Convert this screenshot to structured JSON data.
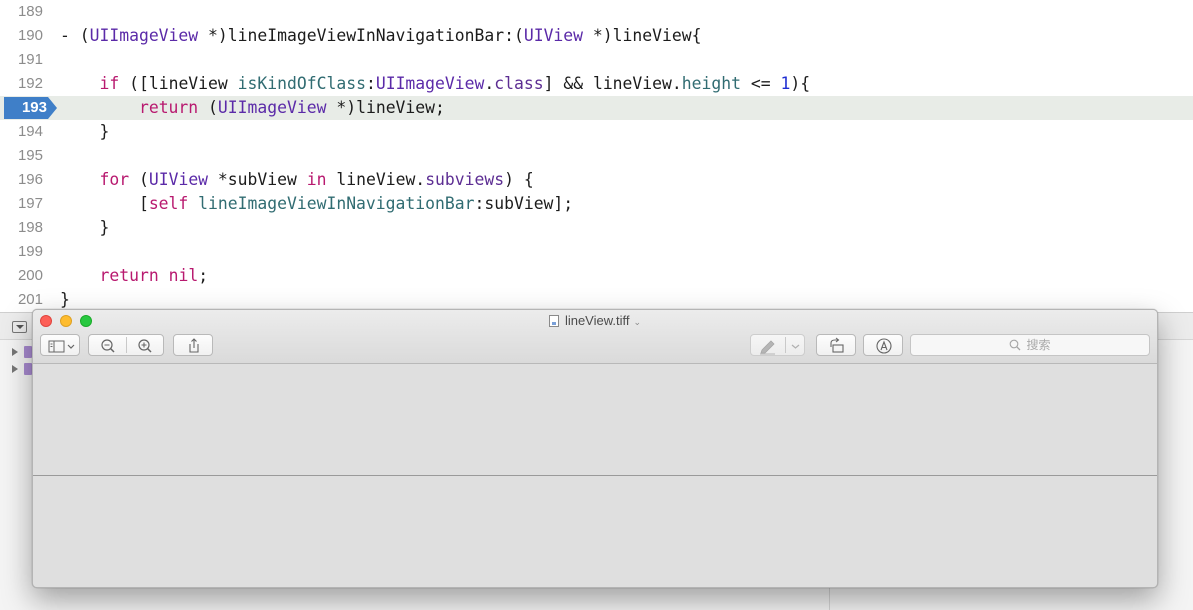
{
  "editor": {
    "lines": [
      {
        "num": "189",
        "tokens": []
      },
      {
        "num": "190",
        "tokens": [
          {
            "t": "- (",
            "c": "plain"
          },
          {
            "t": "UIImageView",
            "c": "type"
          },
          {
            "t": " *)lineImageViewInNavigationBar:(",
            "c": "plain"
          },
          {
            "t": "UIView",
            "c": "type"
          },
          {
            "t": " *)lineView{",
            "c": "plain"
          }
        ]
      },
      {
        "num": "191",
        "tokens": []
      },
      {
        "num": "192",
        "tokens": [
          {
            "t": "    ",
            "c": "plain"
          },
          {
            "t": "if",
            "c": "key"
          },
          {
            "t": " ([lineView ",
            "c": "plain"
          },
          {
            "t": "isKindOfClass",
            "c": "method"
          },
          {
            "t": ":",
            "c": "plain"
          },
          {
            "t": "UIImageView",
            "c": "type"
          },
          {
            "t": ".",
            "c": "plain"
          },
          {
            "t": "class",
            "c": "prop"
          },
          {
            "t": "] && lineView.",
            "c": "plain"
          },
          {
            "t": "height",
            "c": "method"
          },
          {
            "t": " <= ",
            "c": "plain"
          },
          {
            "t": "1",
            "c": "num"
          },
          {
            "t": "){",
            "c": "plain"
          }
        ]
      },
      {
        "num": "193",
        "current": true,
        "tokens": [
          {
            "t": "        ",
            "c": "plain"
          },
          {
            "t": "return",
            "c": "key"
          },
          {
            "t": " (",
            "c": "plain"
          },
          {
            "t": "UIImageView",
            "c": "type"
          },
          {
            "t": " *)lineView;",
            "c": "plain"
          }
        ]
      },
      {
        "num": "194",
        "tokens": [
          {
            "t": "    }",
            "c": "plain"
          }
        ]
      },
      {
        "num": "195",
        "tokens": []
      },
      {
        "num": "196",
        "tokens": [
          {
            "t": "    ",
            "c": "plain"
          },
          {
            "t": "for",
            "c": "key"
          },
          {
            "t": " (",
            "c": "plain"
          },
          {
            "t": "UIView",
            "c": "type"
          },
          {
            "t": " *subView ",
            "c": "plain"
          },
          {
            "t": "in",
            "c": "key"
          },
          {
            "t": " lineView.",
            "c": "plain"
          },
          {
            "t": "subviews",
            "c": "prop"
          },
          {
            "t": ") {",
            "c": "plain"
          }
        ]
      },
      {
        "num": "197",
        "tokens": [
          {
            "t": "        [",
            "c": "plain"
          },
          {
            "t": "self",
            "c": "key"
          },
          {
            "t": " ",
            "c": "plain"
          },
          {
            "t": "lineImageViewInNavigationBar",
            "c": "method"
          },
          {
            "t": ":subView];",
            "c": "plain"
          }
        ]
      },
      {
        "num": "198",
        "tokens": [
          {
            "t": "    }",
            "c": "plain"
          }
        ]
      },
      {
        "num": "199",
        "tokens": []
      },
      {
        "num": "200",
        "tokens": [
          {
            "t": "    ",
            "c": "plain"
          },
          {
            "t": "return",
            "c": "key"
          },
          {
            "t": " ",
            "c": "plain"
          },
          {
            "t": "nil",
            "c": "key"
          },
          {
            "t": ";",
            "c": "plain"
          }
        ]
      },
      {
        "num": "201",
        "tokens": [
          {
            "t": "}",
            "c": "plain"
          }
        ]
      }
    ]
  },
  "colors": {
    "keyword": "#b8196f",
    "type": "#5b2aa8",
    "method": "#316c72",
    "property": "#5d2e93",
    "number": "#1f2ed3",
    "breakpoint": "#3f7fc8",
    "current_line": "#e8ece7"
  },
  "preview_window": {
    "title": "lineView.tiff",
    "search_placeholder": "搜索",
    "toolbar_icons": [
      "sidebar-icon",
      "zoom-out-icon",
      "zoom-in-icon",
      "share-icon",
      "markup-pen-icon",
      "rotate-icon",
      "annotate-icon"
    ]
  }
}
